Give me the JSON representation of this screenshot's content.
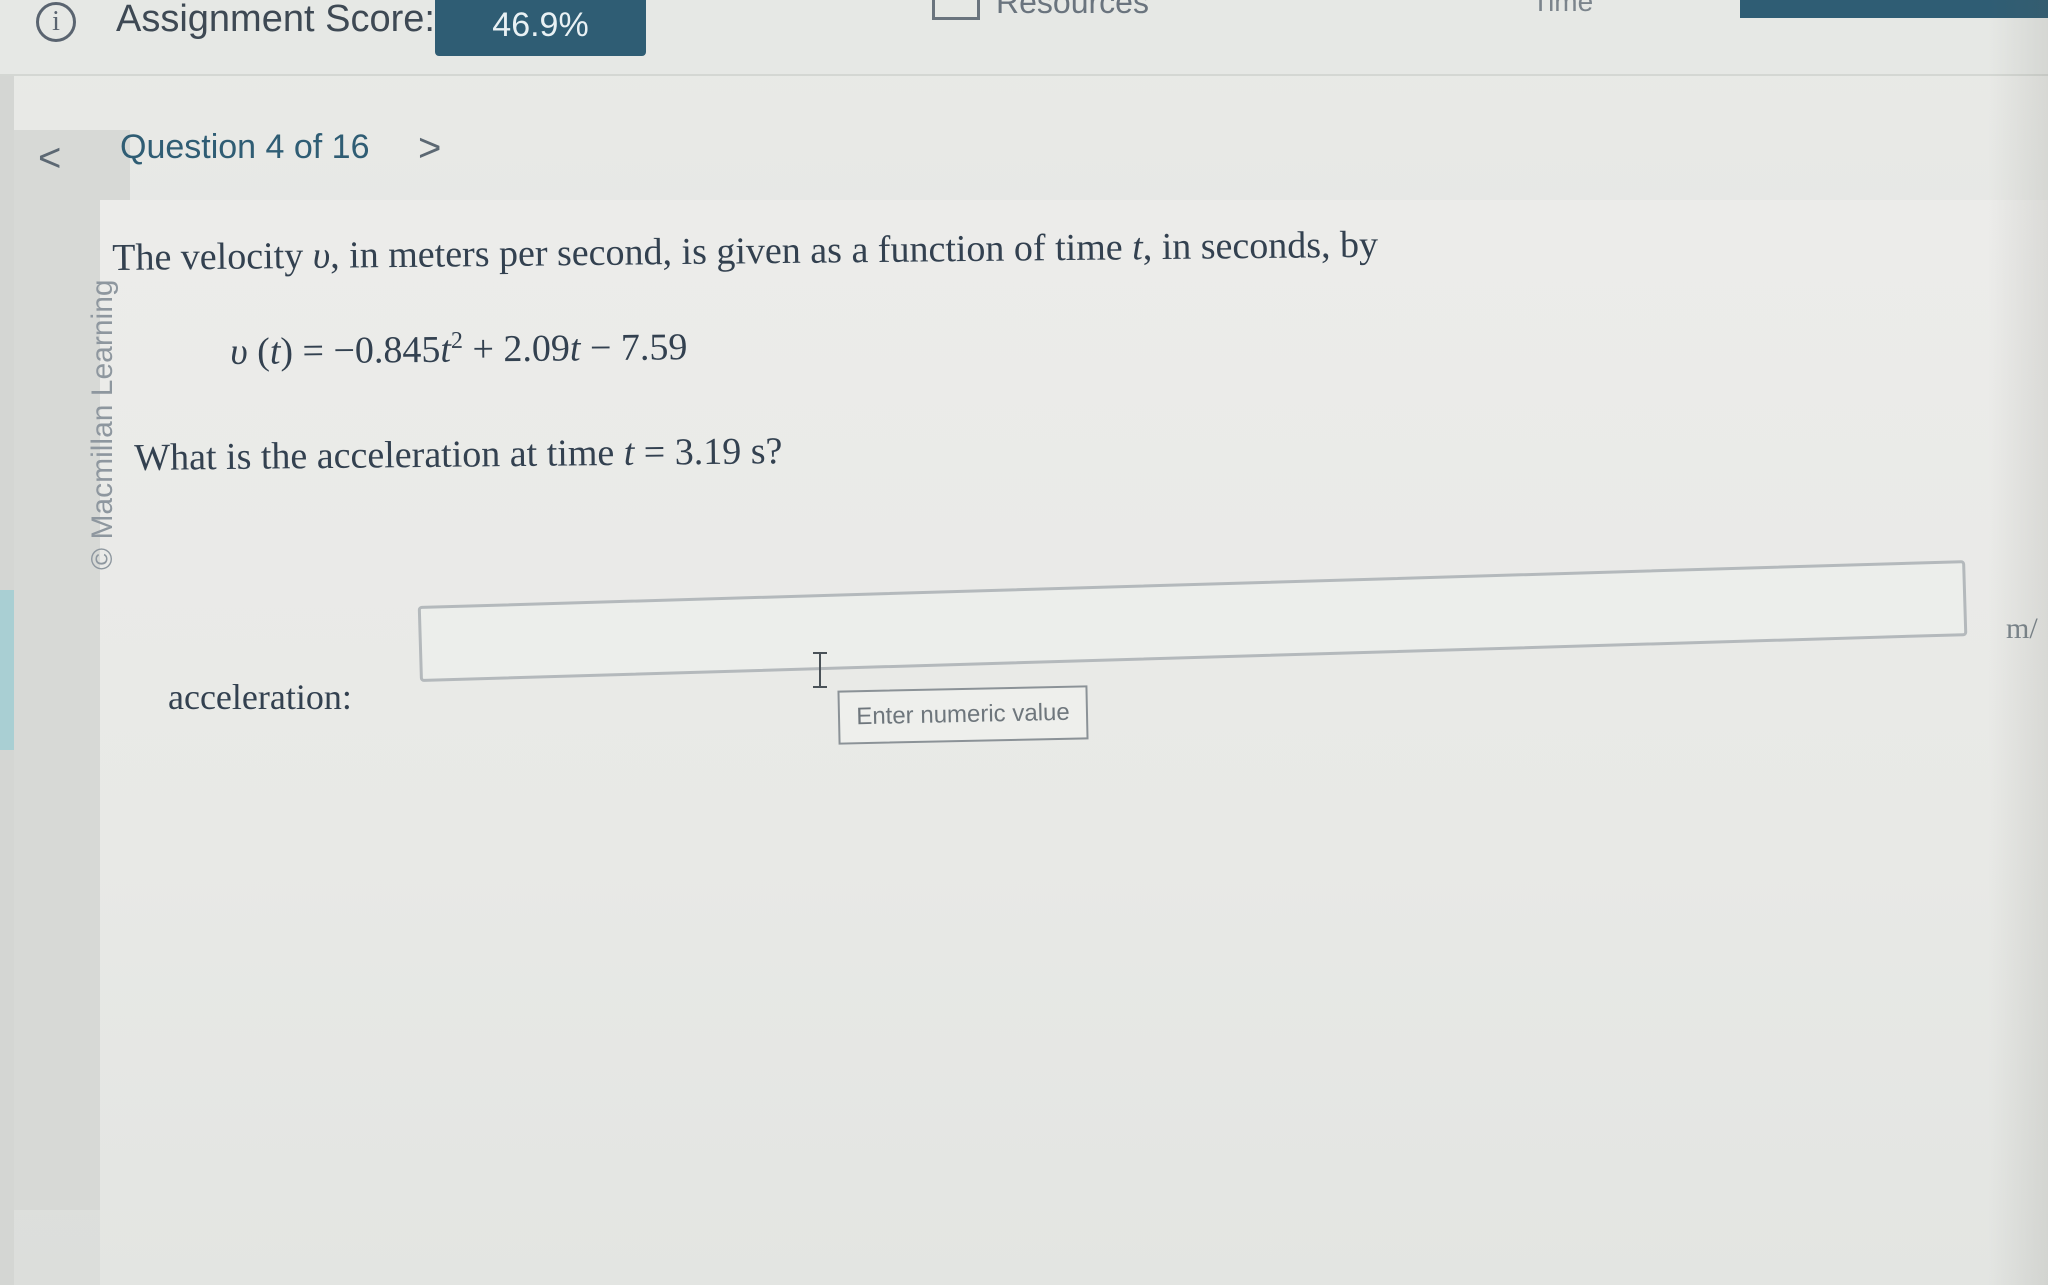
{
  "header": {
    "info_icon_glyph": "i",
    "score_label": "Assignment Score:",
    "score_value": "46.9%",
    "resources_label": "Resources",
    "timer_fragment": "Time",
    "accent_color": "#2f5d74"
  },
  "nav": {
    "prev_glyph": "<",
    "question_title": "Question 4 of 16",
    "next_glyph": ">"
  },
  "copyright": "© Macmillan Learning",
  "problem": {
    "intro_1": "The velocity ",
    "var_v": "υ",
    "intro_2": ", in meters per second, is given as a function of time ",
    "var_t": "t",
    "intro_3": ", in seconds, by",
    "eq_lhs_v": "υ",
    "eq_lhs_paren_open": " (",
    "eq_lhs_t": "t",
    "eq_lhs_paren_close": ")",
    "eq_mid_1": " = −0.845",
    "eq_t1": "t",
    "eq_exp": "2",
    "eq_mid_2": " + 2.09",
    "eq_t2": "t",
    "eq_end": " − 7.59",
    "question_1": "What is the acceleration at time ",
    "question_t": "t",
    "question_2": " = 3.19 s?"
  },
  "answer": {
    "label": "acceleration:",
    "value": "",
    "tooltip": "Enter numeric value",
    "unit": "m/"
  }
}
